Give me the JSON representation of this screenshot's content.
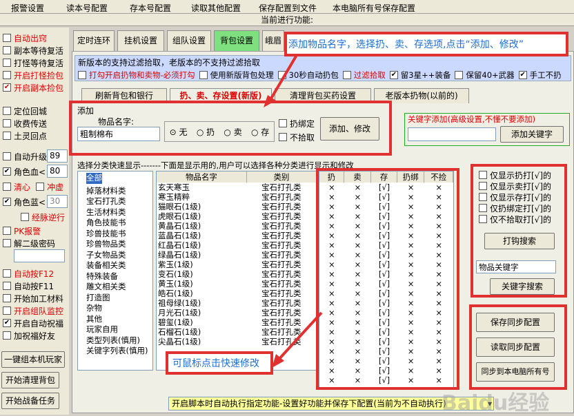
{
  "menu": [
    "报警设置",
    "读本号配置",
    "存本号配置",
    "读取其他配置",
    "保存配置到文件",
    "本电脑所有号保存配置"
  ],
  "current_function": "当前进行功能:",
  "left": {
    "g1": [
      {
        "label": "自动出窍",
        "red": true,
        "checked": false
      },
      {
        "label": "副本等待复活",
        "red": false,
        "checked": false
      },
      {
        "label": "打怪等待复活",
        "red": false,
        "checked": false
      },
      {
        "label": "开启打怪捡包",
        "red": true,
        "checked": false
      },
      {
        "label": "开启副本捡包",
        "red": true,
        "checked": true
      }
    ],
    "g2": [
      {
        "label": "定位回城",
        "checked": false
      },
      {
        "label": "收费传送",
        "checked": false
      },
      {
        "label": "土灵回点",
        "checked": false
      }
    ],
    "auto_upgrade": "自动升级",
    "auto_upgrade_val": "89",
    "hp_label": "角色血<",
    "hp_val": "80",
    "clear_heart": "清心",
    "chong_xu": "冲虚",
    "mp_label": "角色蓝<",
    "mp_val": "30",
    "jingmai": "经脉逆行",
    "pk": "PK报警",
    "pw2": "解二级密码",
    "g3": [
      {
        "label": "自动按F12",
        "red": true,
        "checked": false
      },
      {
        "label": "自动按F11",
        "red": false,
        "checked": false
      },
      {
        "label": "开始加工材料",
        "red": false,
        "checked": false
      },
      {
        "label": "开启组队监控",
        "red": true,
        "checked": false
      },
      {
        "label": "开启自动祝福",
        "red": false,
        "checked": true
      },
      {
        "label": "加祝福好友",
        "red": false,
        "checked": false
      }
    ],
    "btn1": "一键组本机玩家",
    "btn2": "开始清理背包",
    "btn3": "开始战备任务"
  },
  "tabs": [
    "定时连环",
    "挂机设置",
    "组队设置",
    "背包设置",
    "峨眉"
  ],
  "note": "新版本的支持过滤拾取，老版本的不支持过滤拾取",
  "opts": [
    {
      "label": "打勾开启扔物和卖物-必须打勾",
      "red": true,
      "checked": false
    },
    {
      "label": "使用新版背包处理",
      "red": false,
      "checked": false
    },
    {
      "label": "30秒自动扔包",
      "red": false,
      "checked": false
    },
    {
      "label": "过滤拾取",
      "red": true,
      "checked": false
    },
    {
      "label": "留3星++装备",
      "red": false,
      "checked": true
    },
    {
      "label": "保留40+武器",
      "red": false,
      "checked": false
    },
    {
      "label": "手工不扔",
      "red": false,
      "checked": true
    }
  ],
  "subtabs": [
    "刷新背包和银行",
    "扔、卖、存设置(新版)",
    "清理背包买药设置",
    "老版本扔物(以前的)"
  ],
  "add": {
    "legend": "添加",
    "name_label": "物品名字:",
    "name_val": "粗制棉布",
    "radios": [
      "无",
      "扔",
      "卖",
      "存"
    ],
    "bind": "扔绑定",
    "nopick": "不拾取",
    "btn": "添加、修改"
  },
  "kw": {
    "legend": "关键字添加(高级设置,不懂不要添加)",
    "btn": "添加关键字"
  },
  "list_title": "选择分类快速显示-------下面是显示用的,用户可以选择各种分类进行显示和修改",
  "tree": [
    "全部",
    "掉落材料类",
    "宝石打孔类",
    "生活材料类",
    "角色技能书",
    "珍兽技能书",
    "珍兽物品类",
    "子女物品类",
    "装备相关类",
    "特殊装备",
    "雕文相关类",
    "打造图",
    "杂物",
    "其他",
    "玩家自用",
    "类型列表(慎用)",
    "关键字列表(慎用)"
  ],
  "cols": [
    "物品名字",
    "类别",
    "扔",
    "卖",
    "存",
    "扔绑",
    "不捡"
  ],
  "items": [
    "玄天寒玉",
    "寒玉精粹",
    "猫眼石(1级)",
    "虎眼石(1级)",
    "黄晶石(1级)",
    "蓝晶石(1级)",
    "红晶石(1级)",
    "绿晶石(1级)",
    "紫玉(1级)",
    "变石(1级)",
    "黄玉(1级)",
    "皓石(1级)",
    "祖母绿(1级)",
    "月光石(1级)",
    "碧玺(1级)",
    "石榴石(1级)",
    "尖晶石(1级)"
  ],
  "category": "宝石打孔类",
  "mark_x": "×",
  "mark_v": "[√]",
  "filters": [
    "仅显示扔打[√]的",
    "仅显示卖打[√]的",
    "仅显示存打[√]的",
    "仅扔绑定打[√]的",
    "仅不拾取打[√]的"
  ],
  "filter_btn": "打钩搜索",
  "kw_search_label": "物品关键字",
  "kw_search_btn": "关键字搜索",
  "sync": [
    "保存同步配置",
    "读取同步配置",
    "同步到本电脑所有号"
  ],
  "bottom_select": "开启脚本时自动执行指定功能-设置好功能并保存下配置(当前为不自动执行)",
  "ann1": "添加物品名字，选择扔、卖、存选项,点击“添加、修改”",
  "ann2": "可鼠标点击快速修改",
  "watermark": "Baidu经验"
}
